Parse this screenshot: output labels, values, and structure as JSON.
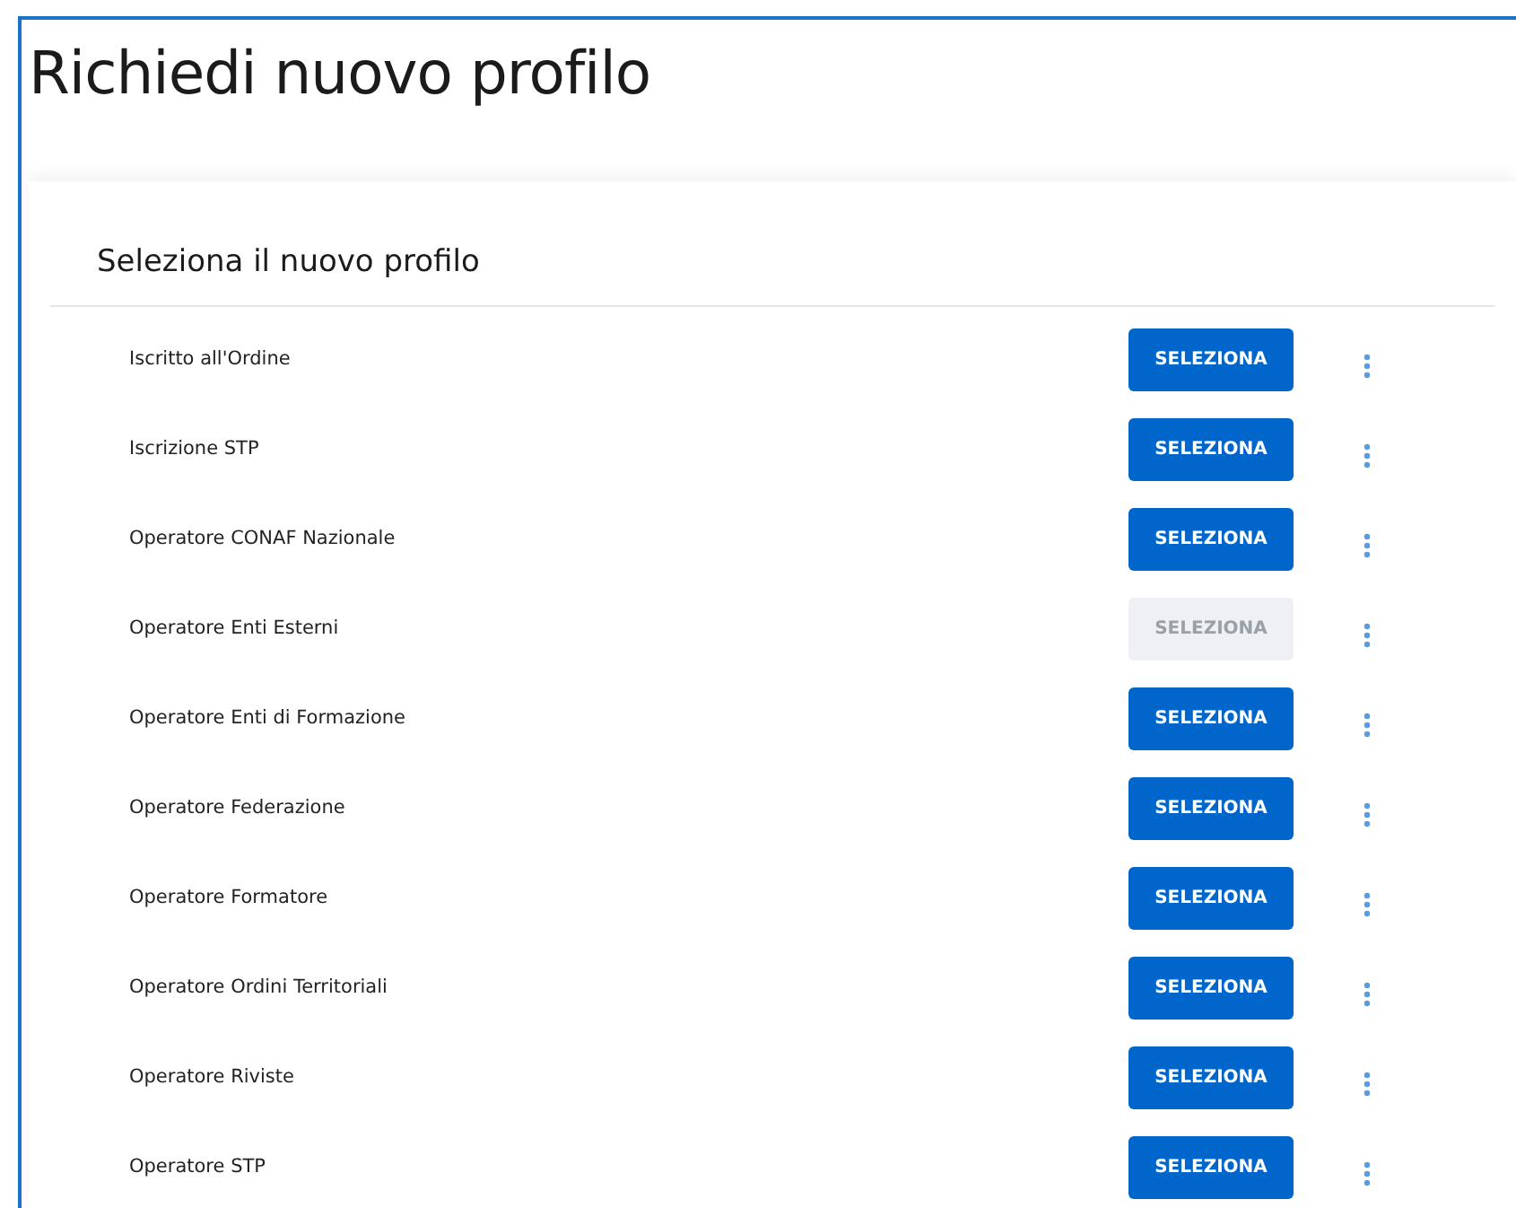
{
  "title": "Richiedi nuovo profilo",
  "card": {
    "heading": "Seleziona il nuovo profilo",
    "profiles": [
      {
        "label": "Iscritto all'Ordine",
        "button": "SELEZIONA",
        "disabled": false
      },
      {
        "label": "Iscrizione STP",
        "button": "SELEZIONA",
        "disabled": false
      },
      {
        "label": "Operatore CONAF Nazionale",
        "button": "SELEZIONA",
        "disabled": false
      },
      {
        "label": "Operatore Enti Esterni",
        "button": "SELEZIONA",
        "disabled": true
      },
      {
        "label": "Operatore Enti di Formazione",
        "button": "SELEZIONA",
        "disabled": false
      },
      {
        "label": "Operatore Federazione",
        "button": "SELEZIONA",
        "disabled": false
      },
      {
        "label": "Operatore Formatore",
        "button": "SELEZIONA",
        "disabled": false
      },
      {
        "label": "Operatore Ordini Territoriali",
        "button": "SELEZIONA",
        "disabled": false
      },
      {
        "label": "Operatore Riviste",
        "button": "SELEZIONA",
        "disabled": false
      },
      {
        "label": "Operatore STP",
        "button": "SELEZIONA",
        "disabled": false
      }
    ]
  }
}
